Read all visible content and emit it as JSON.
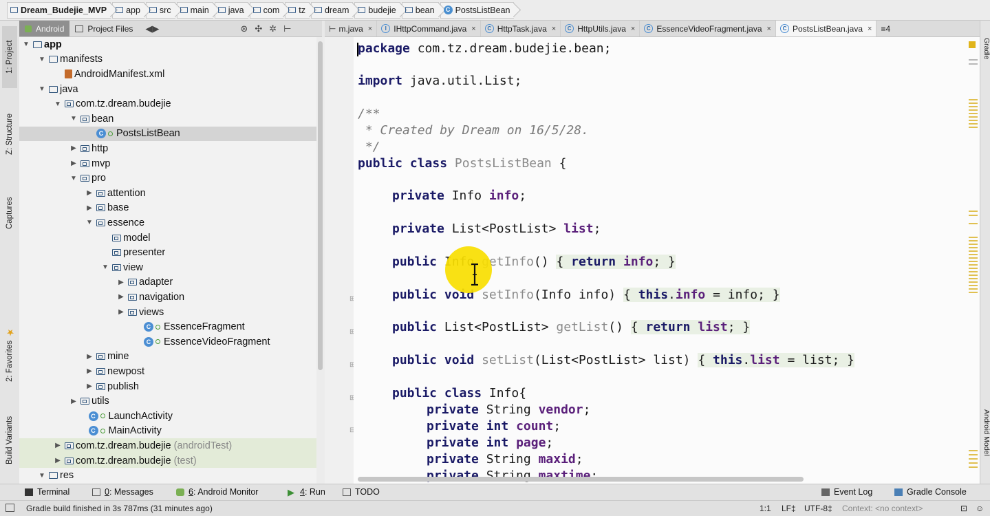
{
  "breadcrumb": [
    "Dream_Budejie_MVP",
    "app",
    "src",
    "main",
    "java",
    "com",
    "tz",
    "dream",
    "budejie",
    "bean",
    "PostsListBean"
  ],
  "left_strip": {
    "project": "1: Project",
    "structure": "Z: Structure",
    "captures": "Captures",
    "favorites": "2: Favorites",
    "build_variants": "Build Variants"
  },
  "right_strip": {
    "gradle": "Gradle",
    "android_model": "Android Model"
  },
  "project_bar": {
    "android_tab": "Android",
    "files_tab": "Project Files",
    "nav_icon": "◀▶"
  },
  "editor_tabs": [
    {
      "label": "m.java",
      "close": "×"
    },
    {
      "label": "IHttpCommand.java",
      "close": "×"
    },
    {
      "label": "HttpTask.java",
      "close": "×"
    },
    {
      "label": "HttpUtils.java",
      "close": "×"
    },
    {
      "label": "EssenceVideoFragment.java",
      "close": "×"
    },
    {
      "label": "PostsListBean.java",
      "close": "×"
    }
  ],
  "tabs_overflow": "≡4",
  "tree": [
    {
      "label": "app",
      "indent": 0,
      "arrow": "▼",
      "kind": "app"
    },
    {
      "label": "manifests",
      "indent": 1,
      "arrow": "▼",
      "kind": "folder"
    },
    {
      "label": "AndroidManifest.xml",
      "indent": 2,
      "arrow": "",
      "kind": "xml"
    },
    {
      "label": "java",
      "indent": 1,
      "arrow": "▼",
      "kind": "folder"
    },
    {
      "label": "com.tz.dream.budejie",
      "indent": 2,
      "arrow": "▼",
      "kind": "pkg"
    },
    {
      "label": "bean",
      "indent": 3,
      "arrow": "▼",
      "kind": "pkg"
    },
    {
      "label": "PostsListBean",
      "indent": 4,
      "arrow": "",
      "kind": "class",
      "selected": true
    },
    {
      "label": "http",
      "indent": 3,
      "arrow": "▶",
      "kind": "pkg"
    },
    {
      "label": "mvp",
      "indent": 3,
      "arrow": "▶",
      "kind": "pkg"
    },
    {
      "label": "pro",
      "indent": 3,
      "arrow": "▼",
      "kind": "pkg"
    },
    {
      "label": "attention",
      "indent": 4,
      "arrow": "▶",
      "kind": "pkg"
    },
    {
      "label": "base",
      "indent": 4,
      "arrow": "▶",
      "kind": "pkg"
    },
    {
      "label": "essence",
      "indent": 4,
      "arrow": "▼",
      "kind": "pkg"
    },
    {
      "label": "model",
      "indent": 5,
      "arrow": "",
      "kind": "pkg"
    },
    {
      "label": "presenter",
      "indent": 5,
      "arrow": "",
      "kind": "pkg"
    },
    {
      "label": "view",
      "indent": 5,
      "arrow": "▼",
      "kind": "pkg"
    },
    {
      "label": "adapter",
      "indent": 6,
      "arrow": "▶",
      "kind": "pkg"
    },
    {
      "label": "navigation",
      "indent": 6,
      "arrow": "▶",
      "kind": "pkg"
    },
    {
      "label": "views",
      "indent": 6,
      "arrow": "▶",
      "kind": "pkg"
    },
    {
      "label": "EssenceFragment",
      "indent": 7,
      "arrow": "",
      "kind": "class"
    },
    {
      "label": "EssenceVideoFragment",
      "indent": 7,
      "arrow": "",
      "kind": "class"
    },
    {
      "label": "mine",
      "indent": 4,
      "arrow": "▶",
      "kind": "pkg"
    },
    {
      "label": "newpost",
      "indent": 4,
      "arrow": "▶",
      "kind": "pkg"
    },
    {
      "label": "publish",
      "indent": 4,
      "arrow": "▶",
      "kind": "pkg"
    },
    {
      "label": "utils",
      "indent": 3,
      "arrow": "▶",
      "kind": "pkg"
    },
    {
      "label": "LaunchActivity",
      "indent": 3.5,
      "arrow": "",
      "kind": "class"
    },
    {
      "label": "MainActivity",
      "indent": 3.5,
      "arrow": "",
      "kind": "class"
    },
    {
      "label": "com.tz.dream.budejie",
      "indent": 2,
      "arrow": "▶",
      "kind": "pkg",
      "suffix": "(androidTest)",
      "green": true
    },
    {
      "label": "com.tz.dream.budejie",
      "indent": 2,
      "arrow": "▶",
      "kind": "pkg",
      "suffix": "(test)",
      "green": true
    },
    {
      "label": "res",
      "indent": 1,
      "arrow": "▼",
      "kind": "res"
    }
  ],
  "code": {
    "package_kw": "package",
    "package_name": " com.tz.dream.budejie.bean;",
    "import_kw": "import",
    "import_name": " java.util.List;",
    "doc_open": "/**",
    "doc_body": " * Created by Dream on 16/5/28.",
    "doc_close": " */",
    "class_kw": "public class",
    "class_name": "PostsListBean",
    "class_brace": " {",
    "private_kw": "private",
    "public_kw": "public",
    "void_kw": "void",
    "return_kw": "return",
    "this_kw": "this",
    "int_kw": "int",
    "info_type": " Info ",
    "info_field": "info",
    "list_type": " List<PostList> ",
    "list_field": "list",
    "get_info": "getInfo",
    "set_info": "setInfo",
    "get_list": "getList",
    "set_list": "setList",
    "info_param": "(Info info)",
    "list_param": "(List<PostList> list)",
    "ret_info_type": " Info ",
    "ret_list_type": " List<PostList> ",
    "inner_class_name": " Info{",
    "string_type": " String ",
    "vendor": "vendor",
    "count": "count",
    "page": "page",
    "maxid": "maxid",
    "maxtime": "maxtime"
  },
  "bottom_tools": {
    "terminal": "Terminal",
    "messages_num": "0",
    "messages": ": Messages",
    "monitor_num": "6",
    "monitor": ": Android Monitor",
    "run_num": "4",
    "run": ": Run",
    "todo": "TODO",
    "event_log": "Event Log",
    "gradle_console": "Gradle Console"
  },
  "status": {
    "message": "Gradle build finished in 3s 787ms (31 minutes ago)",
    "position": "1:1",
    "line_sep": "LF‡",
    "encoding": "UTF-8‡",
    "context": "Context: <no context>"
  },
  "colors": {
    "keyword": "#1a1a66",
    "field": "#5a1f7a",
    "doc_bg": "#f6eccf",
    "cursor_highlight": "#f9de00",
    "selection": "#d4d4d4"
  }
}
